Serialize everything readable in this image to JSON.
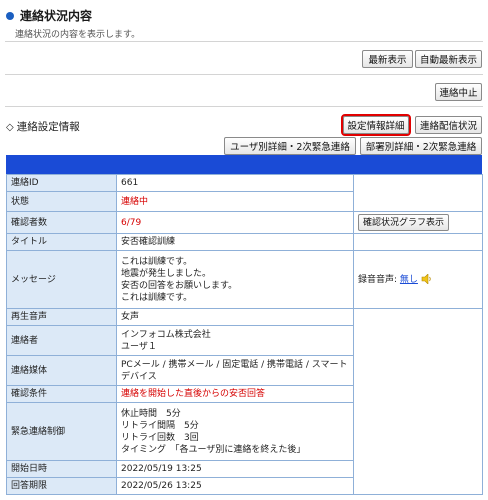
{
  "header": {
    "title": "連絡状況内容",
    "subtitle": "連絡状況の内容を表示します。"
  },
  "toolbar": {
    "latest_label": "最新表示",
    "auto_latest_label": "自動最新表示",
    "stop_label": "連絡中止"
  },
  "section": {
    "title": "連絡設定情報",
    "settings_detail_label": "設定情報詳細",
    "delivery_status_label": "連絡配信状況",
    "user_detail_label": "ユーザ別詳細・2次緊急連絡",
    "dept_detail_label": "部署別詳細・2次緊急連絡"
  },
  "rows": {
    "contact_id": {
      "label": "連絡ID",
      "value": "661"
    },
    "status": {
      "label": "状態",
      "value": "連絡中"
    },
    "confirmed": {
      "label": "確認者数",
      "value": "6/79",
      "graph_button": "確認状況グラフ表示"
    },
    "title": {
      "label": "タイトル",
      "value": "安否確認訓練"
    },
    "message": {
      "label": "メッセージ",
      "lines": [
        "これは訓練です。",
        "地震が発生しました。",
        "安否の回答をお願いします。",
        "これは訓練です。"
      ],
      "recording_label": "録音音声:",
      "recording_value": "無し"
    },
    "playback": {
      "label": "再生音声",
      "value": "女声"
    },
    "sender": {
      "label": "連絡者",
      "lines": [
        "インフォコム株式会社",
        "ユーザ１"
      ]
    },
    "media": {
      "label": "連絡媒体",
      "lines": [
        "PCメール / 携帯メール / 固定電話 / 携帯電話 / スマート",
        "デバイス"
      ]
    },
    "condition": {
      "label": "確認条件",
      "value": "連絡を開始した直後からの安否回答"
    },
    "emergency": {
      "label": "緊急連絡制御",
      "lines": [
        "休止時間　5分",
        "リトライ間隔　5分",
        "リトライ回数　3回",
        "タイミング　「各ユーザ別に連絡を終えた後」"
      ]
    },
    "start": {
      "label": "開始日時",
      "value": "2022/05/19 13:25"
    },
    "deadline": {
      "label": "回答期限",
      "value": "2022/05/26 13:25"
    }
  },
  "colors": {
    "accent": "#1a4bd6",
    "label_bg": "#dce9f7",
    "alert_red": "#d60000"
  }
}
